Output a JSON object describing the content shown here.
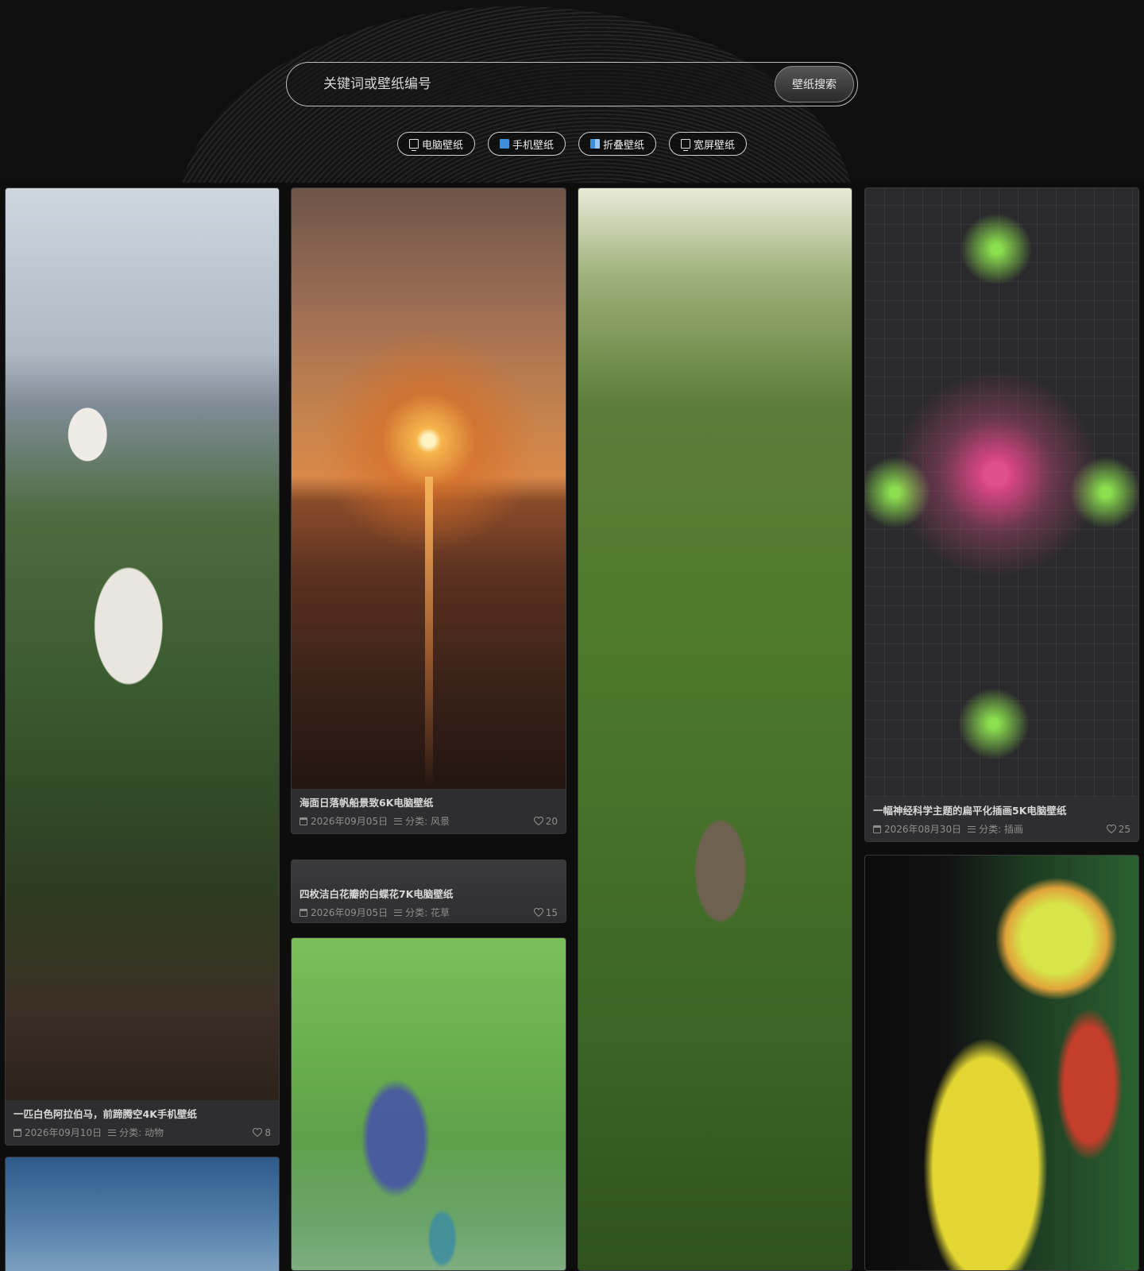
{
  "search": {
    "placeholder": "关键词或壁纸编号",
    "button_label": "壁纸搜索"
  },
  "categories": [
    {
      "label": "电脑壁纸",
      "icon": "monitor-icon"
    },
    {
      "label": "手机壁纸",
      "icon": "phone-icon"
    },
    {
      "label": "折叠壁纸",
      "icon": "fold-phone-icon"
    },
    {
      "label": "宽屏壁纸",
      "icon": "widescreen-icon"
    }
  ],
  "cards": [
    {
      "title": "一匹白色阿拉伯马，前蹄腾空4K手机壁纸",
      "date": "2026年09月10日",
      "category": "分类: 动物",
      "likes": "8"
    },
    {
      "title": "海面日落帆船景致6K电脑壁纸",
      "date": "2026年09月05日",
      "category": "分类: 风景",
      "likes": "20"
    },
    {
      "title": "四枚洁白花瓣的白蝶花7K电脑壁纸",
      "date": "2026年09月05日",
      "category": "分类: 花草",
      "likes": "15"
    },
    {
      "title": "一幅神经科学主题的扁平化插画5K电脑壁纸",
      "date": "2026年08月30日",
      "category": "分类: 插画",
      "likes": "25"
    }
  ],
  "colors": {
    "background": "#0d0d0d",
    "card_bg": "#2e2e30",
    "meta_text": "#8e8e8e",
    "phone_icon_blue": "#3f8fd8"
  }
}
